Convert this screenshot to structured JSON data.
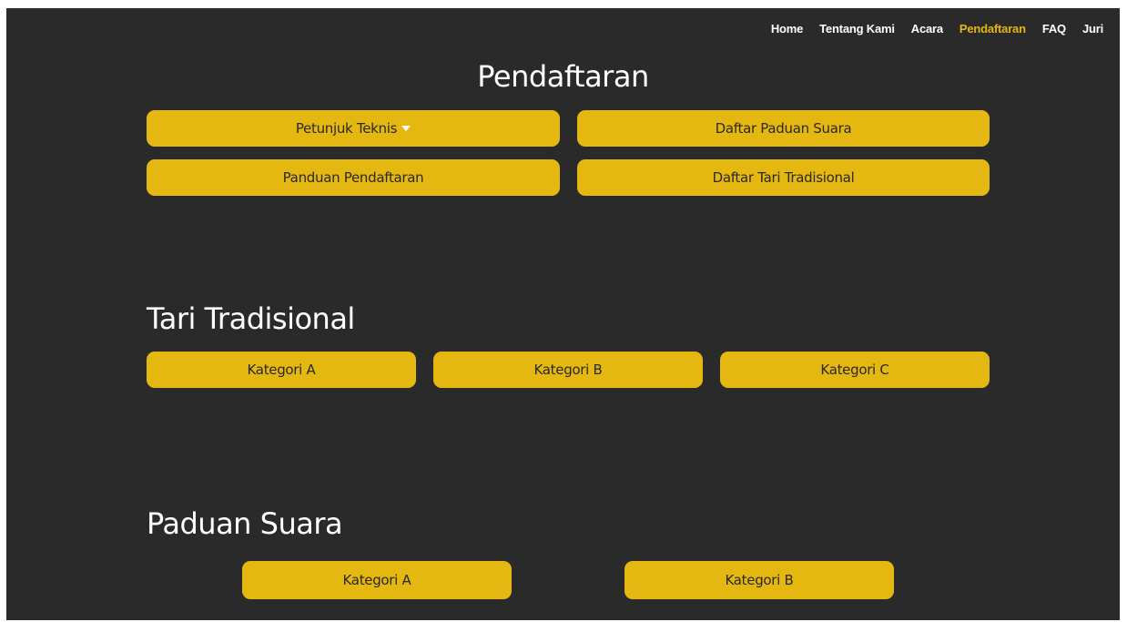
{
  "nav": {
    "items": [
      {
        "label": "Home",
        "active": false
      },
      {
        "label": "Tentang Kami",
        "active": false
      },
      {
        "label": "Acara",
        "active": false
      },
      {
        "label": "Pendaftaran",
        "active": true
      },
      {
        "label": "FAQ",
        "active": false
      },
      {
        "label": "Juri",
        "active": false
      }
    ]
  },
  "header": {
    "title": "Pendaftaran"
  },
  "top_buttons": {
    "petunjuk_teknis": "Petunjuk Teknis",
    "daftar_paduan_suara": "Daftar Paduan Suara",
    "panduan_pendaftaran": "Panduan Pendaftaran",
    "daftar_tari_tradisional": "Daftar Tari Tradisional"
  },
  "tari_tradisional": {
    "title": "Tari Tradisional",
    "categories": [
      "Kategori A",
      "Kategori B",
      "Kategori C"
    ]
  },
  "paduan_suara": {
    "title": "Paduan Suara",
    "categories": [
      "Kategori A",
      "Kategori B"
    ]
  },
  "colors": {
    "background": "#2a2a2a",
    "accent": "#e5b711",
    "text": "#ffffff"
  },
  "icons": {
    "dropdown": "caret-down-icon"
  }
}
